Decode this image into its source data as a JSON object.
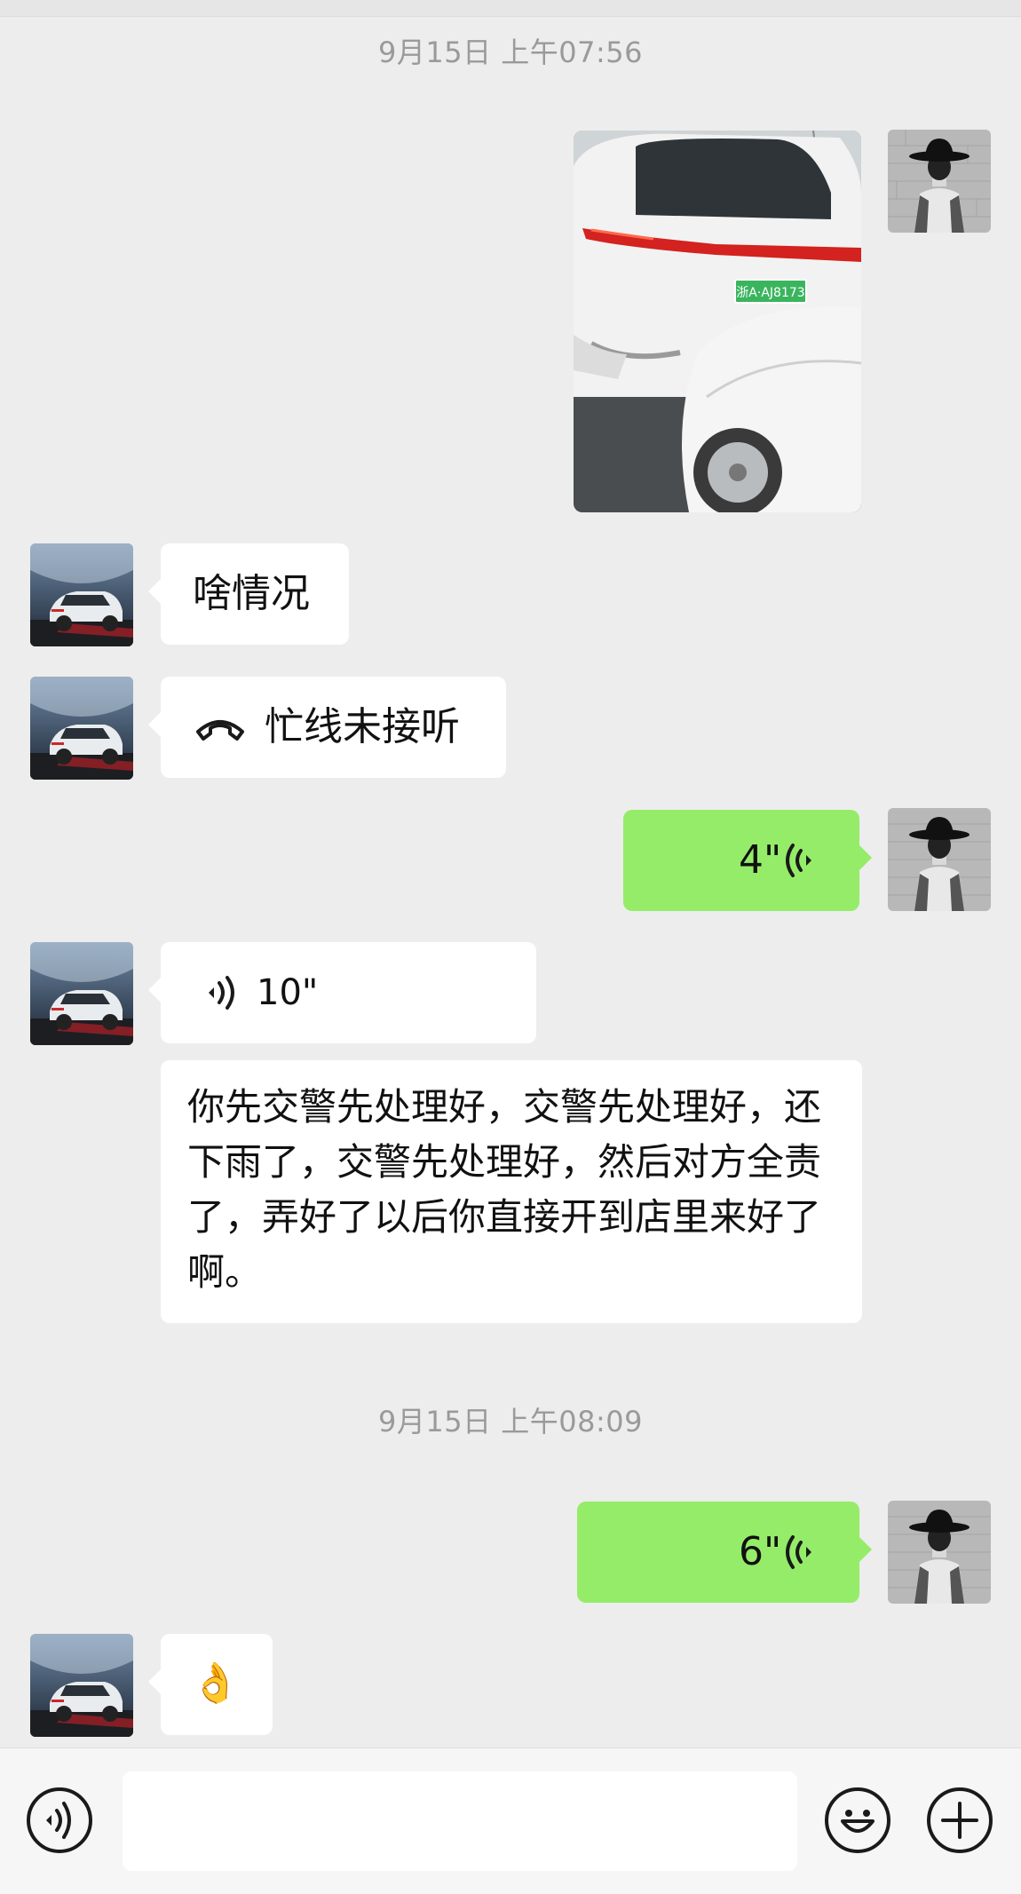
{
  "timestamps": [
    "9月15日 上午07:56",
    "9月15日 上午08:09"
  ],
  "messages": {
    "m1_text": "啥情况",
    "m2_call": "忙线未接听",
    "m3_voice": "4\"",
    "m4_voice": "10\"",
    "m5_text": "你先交警先处理好，交警先处理好，还下雨了，交警先处理好，然后对方全责了，弄好了以后你直接开到店里来好了啊。",
    "m6_voice": "6\"",
    "m7_emoji": "👌"
  },
  "photo": {
    "plate_text": "浙A·AJ8173"
  },
  "icons": {
    "call": "hangup-phone-icon",
    "voice_in": "voice-wave-icon",
    "voice_out": "voice-wave-icon",
    "input_voice": "voice-mode-icon",
    "emoji": "emoji-icon",
    "plus": "plus-icon"
  },
  "colors": {
    "background": "#ededed",
    "outgoing_bubble": "#95ec69",
    "incoming_bubble": "#ffffff",
    "timestamp": "#9a9a9a"
  }
}
